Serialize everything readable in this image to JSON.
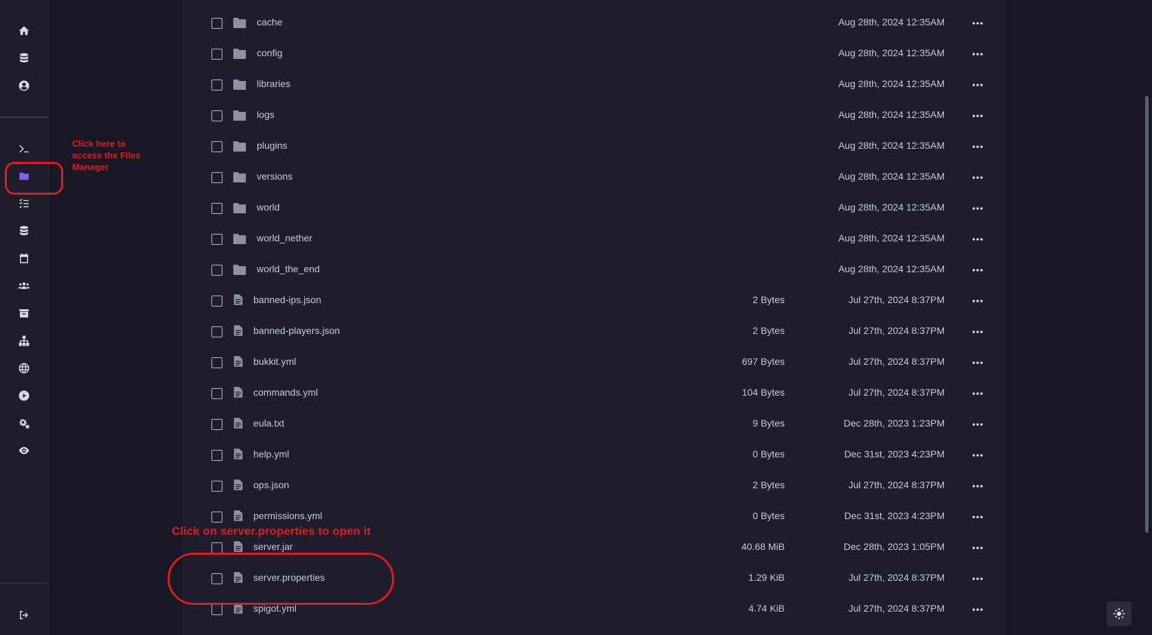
{
  "annotations": {
    "files_manager_hint": "Click here to access the Files Manager",
    "server_properties_hint": "Click on server.properties to open it"
  },
  "nav": [
    {
      "id": "home",
      "icon": "home-icon"
    },
    {
      "id": "servers",
      "icon": "database-stack-icon"
    },
    {
      "id": "account",
      "icon": "user-circle-icon"
    },
    {
      "id": "console",
      "icon": "terminal-icon"
    },
    {
      "id": "files",
      "icon": "folder-icon",
      "active": true
    },
    {
      "id": "tasks",
      "icon": "checklist-icon"
    },
    {
      "id": "databases",
      "icon": "database-icon"
    },
    {
      "id": "schedules",
      "icon": "calendar-icon"
    },
    {
      "id": "users",
      "icon": "users-icon"
    },
    {
      "id": "backups",
      "icon": "archive-icon"
    },
    {
      "id": "network",
      "icon": "network-icon"
    },
    {
      "id": "web",
      "icon": "globe-icon"
    },
    {
      "id": "startup",
      "icon": "play-icon"
    },
    {
      "id": "settings",
      "icon": "gears-icon"
    },
    {
      "id": "activity",
      "icon": "eye-icon"
    },
    {
      "id": "logout",
      "icon": "logout-icon"
    }
  ],
  "files": [
    {
      "type": "folder",
      "name": "cache",
      "size": "",
      "date": "Aug 28th, 2024 12:35AM"
    },
    {
      "type": "folder",
      "name": "config",
      "size": "",
      "date": "Aug 28th, 2024 12:35AM"
    },
    {
      "type": "folder",
      "name": "libraries",
      "size": "",
      "date": "Aug 28th, 2024 12:35AM"
    },
    {
      "type": "folder",
      "name": "logs",
      "size": "",
      "date": "Aug 28th, 2024 12:35AM"
    },
    {
      "type": "folder",
      "name": "plugins",
      "size": "",
      "date": "Aug 28th, 2024 12:35AM"
    },
    {
      "type": "folder",
      "name": "versions",
      "size": "",
      "date": "Aug 28th, 2024 12:35AM"
    },
    {
      "type": "folder",
      "name": "world",
      "size": "",
      "date": "Aug 28th, 2024 12:35AM"
    },
    {
      "type": "folder",
      "name": "world_nether",
      "size": "",
      "date": "Aug 28th, 2024 12:35AM"
    },
    {
      "type": "folder",
      "name": "world_the_end",
      "size": "",
      "date": "Aug 28th, 2024 12:35AM"
    },
    {
      "type": "file",
      "name": "banned-ips.json",
      "size": "2 Bytes",
      "date": "Jul 27th, 2024 8:37PM"
    },
    {
      "type": "file",
      "name": "banned-players.json",
      "size": "2 Bytes",
      "date": "Jul 27th, 2024 8:37PM"
    },
    {
      "type": "file",
      "name": "bukkit.yml",
      "size": "697 Bytes",
      "date": "Jul 27th, 2024 8:37PM"
    },
    {
      "type": "file",
      "name": "commands.yml",
      "size": "104 Bytes",
      "date": "Jul 27th, 2024 8:37PM"
    },
    {
      "type": "file",
      "name": "eula.txt",
      "size": "9 Bytes",
      "date": "Dec 28th, 2023 1:23PM"
    },
    {
      "type": "file",
      "name": "help.yml",
      "size": "0 Bytes",
      "date": "Dec 31st, 2023 4:23PM"
    },
    {
      "type": "file",
      "name": "ops.json",
      "size": "2 Bytes",
      "date": "Jul 27th, 2024 8:37PM"
    },
    {
      "type": "file",
      "name": "permissions.yml",
      "size": "0 Bytes",
      "date": "Dec 31st, 2023 4:23PM"
    },
    {
      "type": "file",
      "name": "server.jar",
      "size": "40.68 MiB",
      "date": "Dec 28th, 2023 1:05PM"
    },
    {
      "type": "file",
      "name": "server.properties",
      "size": "1.29 KiB",
      "date": "Jul 27th, 2024 8:37PM"
    },
    {
      "type": "file",
      "name": "spigot.yml",
      "size": "4.74 KiB",
      "date": "Jul 27th, 2024 8:37PM"
    }
  ],
  "colors": {
    "accent": "#8a5cf6",
    "annotation": "#e3191e",
    "bg": "#181824",
    "panel": "#1d1d2b"
  }
}
